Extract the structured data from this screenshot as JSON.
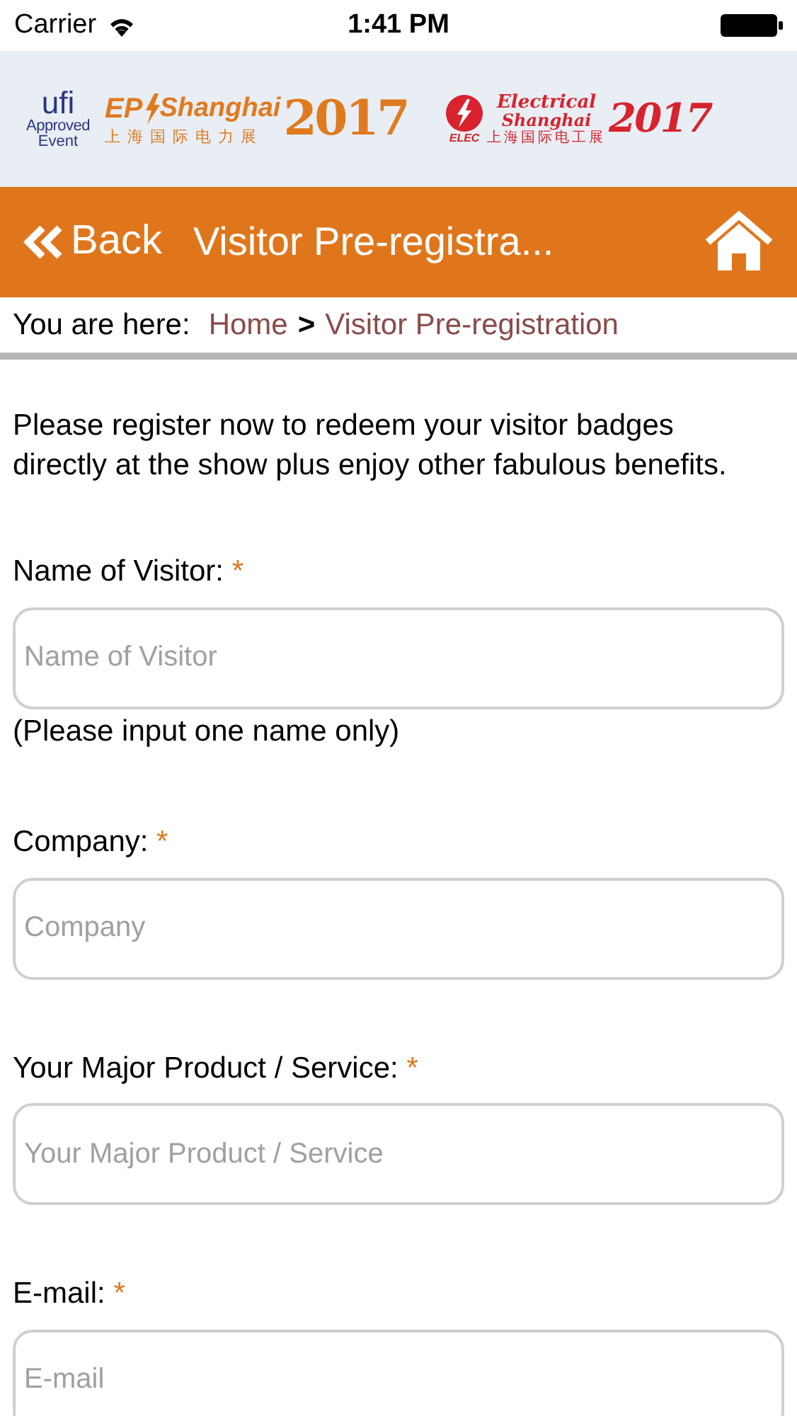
{
  "status_bar": {
    "carrier": "Carrier",
    "time": "1:41 PM"
  },
  "banner": {
    "ufi": {
      "name": "ufi",
      "line1": "Approved",
      "line2": "Event"
    },
    "ep": {
      "name": "EP",
      "city": "Shanghai",
      "year": "2017",
      "chinese": "上海国际电力展"
    },
    "elec": {
      "name": "Electrical",
      "city": "Shanghai",
      "year": "2017",
      "badge": "ELEC",
      "chinese": "上海国际电工展"
    }
  },
  "nav_bar": {
    "back": "Back",
    "title": "Visitor Pre-registra..."
  },
  "breadcrumb": {
    "prefix": "You are here:",
    "items": [
      "Home",
      "Visitor Pre-registration"
    ],
    "separator": ">"
  },
  "required_marker": "*",
  "intro": "Please register now to redeem your visitor badges directly at the show plus enjoy other fabulous benefits.",
  "fields": [
    {
      "label": "Name of Visitor:",
      "required": true,
      "placeholder": "Name of Visitor",
      "hint": "(Please input one name only)"
    },
    {
      "label": "Company:",
      "required": true,
      "placeholder": "Company"
    },
    {
      "label": "Your Major Product / Service:",
      "required": true,
      "placeholder": "Your Major Product / Service"
    },
    {
      "label": "E-mail:",
      "required": true,
      "placeholder": "E-mail"
    }
  ]
}
